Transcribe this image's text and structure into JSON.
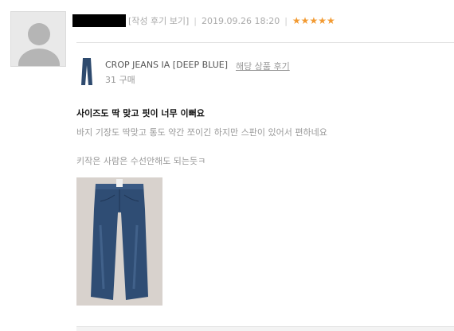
{
  "review": {
    "view_label": "[작성 후기 보기]",
    "separator": "|",
    "date": "2019.09.26 18:20",
    "stars": "★★★★★",
    "rating": 5,
    "title": "사이즈도 딱 맞고 핏이 너무 이뻐요",
    "body_line1": "바지 기장도 딱맞고 통도 약간 쪼이긴 하지만 스판이 있어서 편하네요",
    "body_line2": "키작은 사람은 수선안해도 되는듯ㅋ"
  },
  "product": {
    "name": "CROP JEANS IA [DEEP BLUE]",
    "link_label": "해당 상품 후기",
    "purchase_count": "31 구매"
  },
  "colors": {
    "star": "#f29a32",
    "denim": "#2e4a6e"
  }
}
